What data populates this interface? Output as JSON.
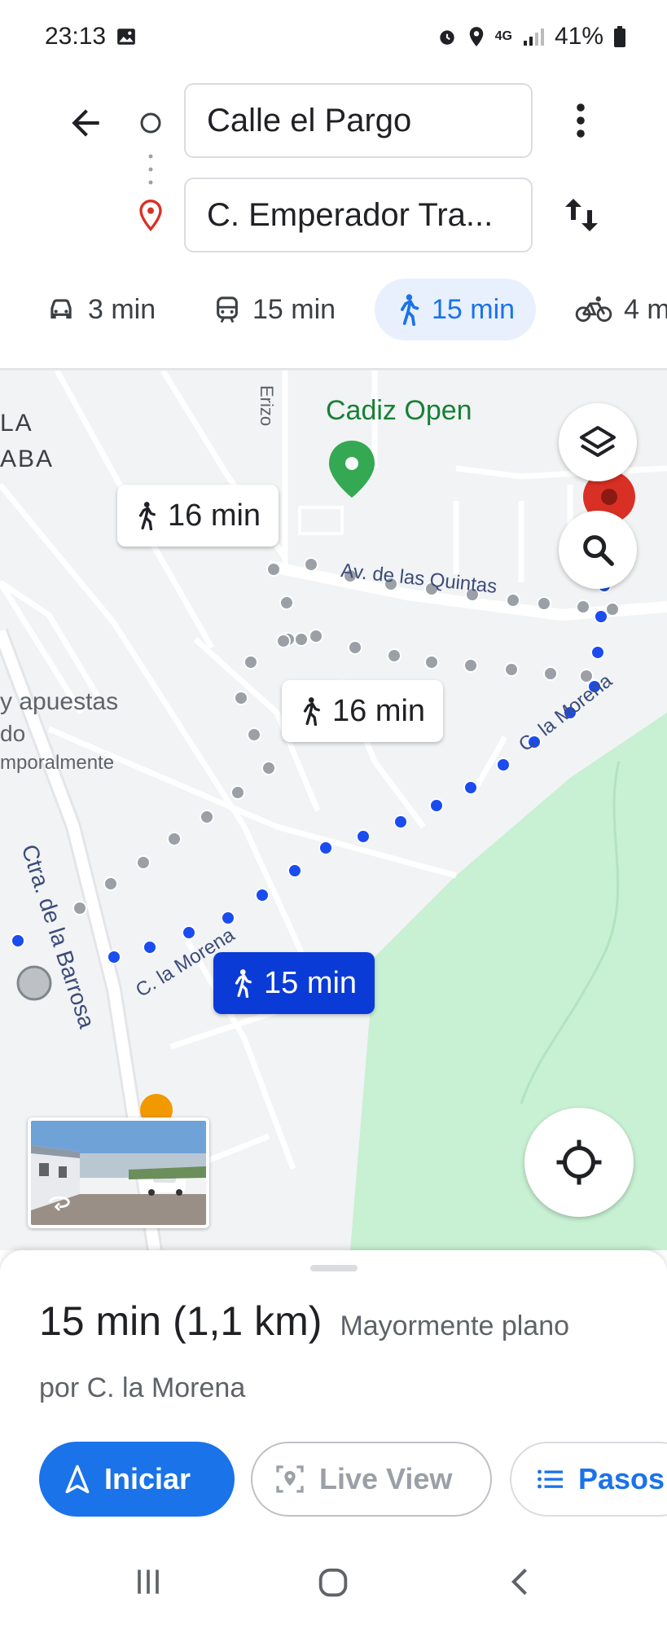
{
  "status": {
    "time": "23:13",
    "network": "4G",
    "battery": "41%"
  },
  "route": {
    "origin": "Calle el Pargo",
    "destination": "C. Emperador Tra..."
  },
  "modes": [
    {
      "name": "car",
      "label": "3 min"
    },
    {
      "name": "transit",
      "label": "15 min"
    },
    {
      "name": "walk",
      "label": "15 min",
      "selected": true
    },
    {
      "name": "bike",
      "label": "4 m"
    }
  ],
  "map": {
    "labels": {
      "area1": "LA",
      "area2": "ABA",
      "place": "Cadiz Open",
      "street_top": "Av. de las Quintas",
      "street_morena_upper": "C. la Morena",
      "street_morena_lower": "C. la Morena",
      "street_barrosa": "Ctra. de la Barrosa",
      "poi_line1": "y apuestas",
      "poi_line2": "do",
      "poi_line3": "mporalmente",
      "street_vertical": "Erizo"
    },
    "route_bubbles": {
      "alt1": "16 min",
      "alt2": "16 min",
      "selected": "15 min"
    }
  },
  "summary": {
    "duration": "15 min",
    "distance": "(1,1 km)",
    "terrain": "Mayormente plano",
    "via": "por C. la Morena"
  },
  "actions": {
    "start": "Iniciar",
    "live_view": "Live View",
    "steps": "Pasos"
  },
  "colors": {
    "accent": "#1a73e8",
    "route": "#1a4cf0",
    "park": "#c8f0d2",
    "pin_red": "#d93025",
    "pin_green": "#34a853"
  }
}
